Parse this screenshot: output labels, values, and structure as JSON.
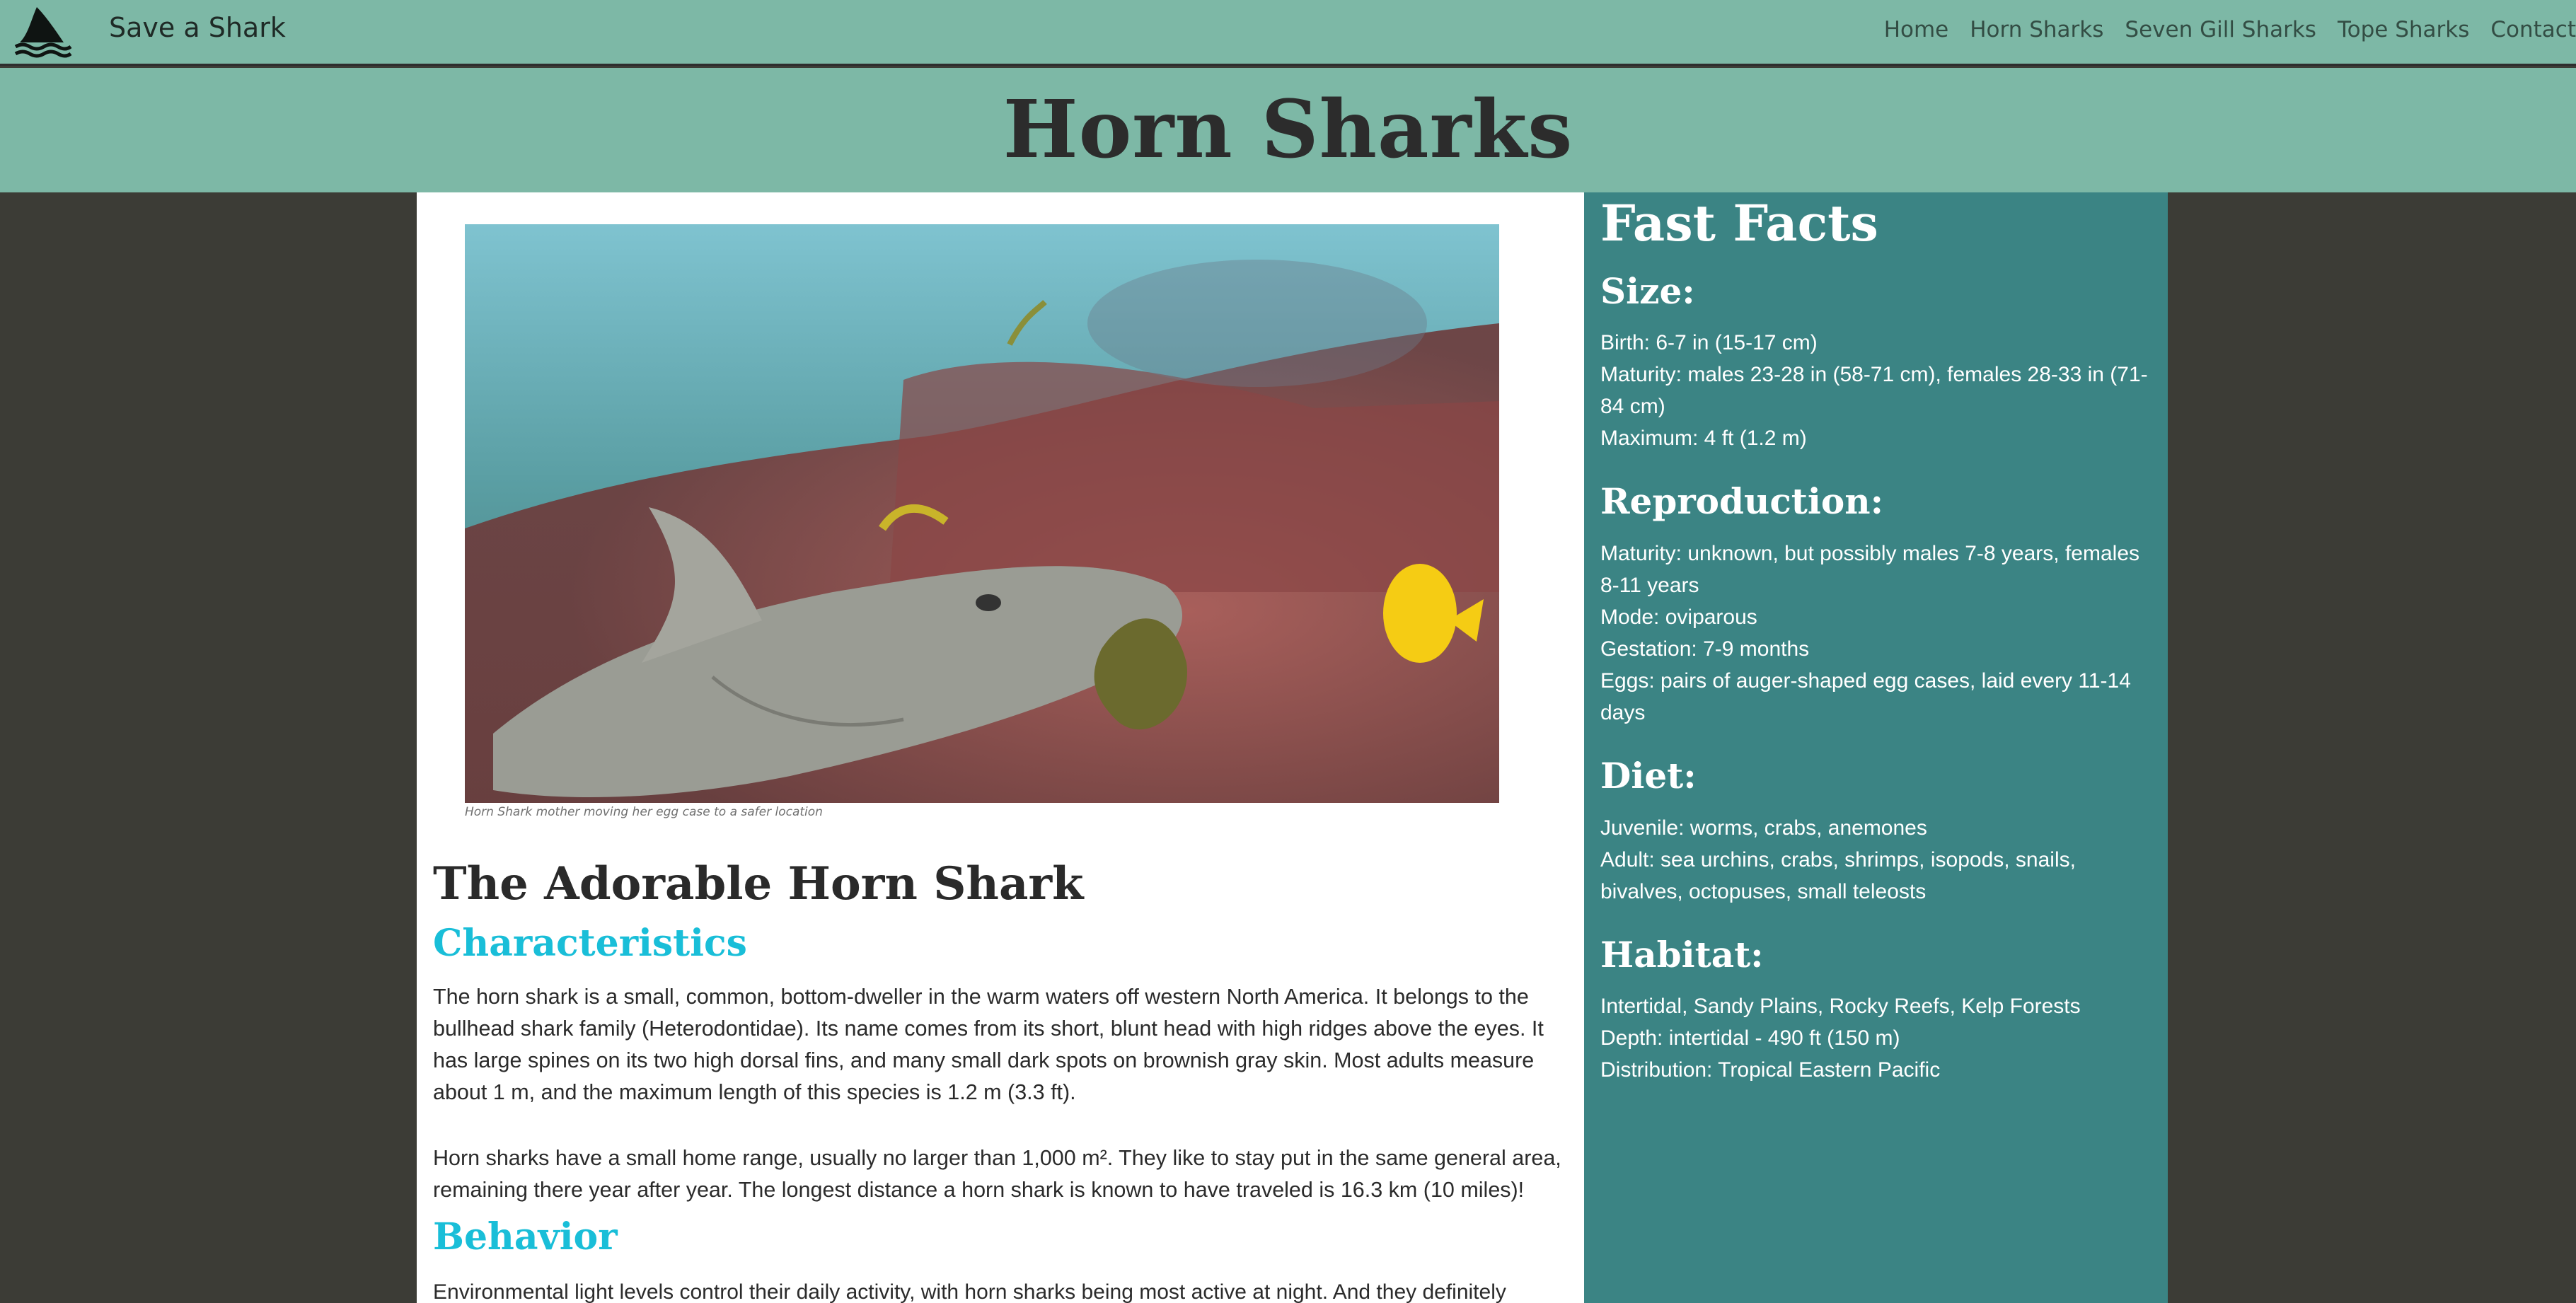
{
  "navbar": {
    "brand": "Save a Shark",
    "links": [
      "Home",
      "Horn Sharks",
      "Seven Gill Sharks",
      "Tope Sharks",
      "Contact"
    ]
  },
  "banner": {
    "title": "Horn Sharks"
  },
  "main": {
    "image_caption": "Horn Shark mother moving her egg case to a safer location",
    "heading": "The Adorable Horn Shark",
    "sections": [
      {
        "title": "Characteristics",
        "paragraphs": [
          "The horn shark is a small, common, bottom-dweller in the warm waters off western North America. It belongs to the bullhead shark family (Heterodontidae). Its name comes from its short, blunt head with high ridges above the eyes. It has large spines on its two high dorsal fins, and many small dark spots on brownish gray skin. Most adults measure about 1 m, and the maximum length of this species is 1.2 m (3.3 ft).",
          "Horn sharks have a small home range, usually no larger than 1,000 m². They like to stay put in the same general area, remaining there year after year. The longest distance a horn shark is known to have traveled is 16.3 km (10 miles)!"
        ]
      },
      {
        "title": "Behavior",
        "paragraphs": [
          "Environmental light levels control their daily activity, with horn sharks being most active at night. And they definitely"
        ]
      }
    ]
  },
  "fast_facts": {
    "title": "Fast Facts",
    "groups": [
      {
        "title": "Size:",
        "lines": [
          "Birth: 6-7 in (15-17 cm)",
          "Maturity: males 23-28 in (58-71 cm), females 28-33 in (71-84 cm)",
          "Maximum: 4 ft (1.2 m)"
        ]
      },
      {
        "title": "Reproduction:",
        "lines": [
          "Maturity: unknown, but possibly males 7-8 years, females 8-11 years",
          "Mode: oviparous",
          "Gestation: 7-9 months",
          "Eggs: pairs of auger-shaped egg cases, laid every 11-14 days"
        ]
      },
      {
        "title": "Diet:",
        "lines": [
          "Juvenile: worms, crabs, anemones",
          "Adult: sea urchins, crabs, shrimps, isopods, snails, bivalves, octopuses, small teleosts"
        ]
      },
      {
        "title": "Habitat:",
        "lines": [
          "Intertidal, Sandy Plains, Rocky Reefs, Kelp Forests",
          "Depth: intertidal - 490 ft (150 m)",
          "Distribution: Tropical Eastern Pacific"
        ]
      }
    ]
  },
  "colors": {
    "header_bg": "#7db8a6",
    "page_bg": "#3c3c36",
    "sidebar_bg": "#3b8484",
    "section_title": "#19bed8",
    "heading_text": "#2a2a2a"
  },
  "icons": {
    "logo": "shark-fin-waves-icon"
  }
}
